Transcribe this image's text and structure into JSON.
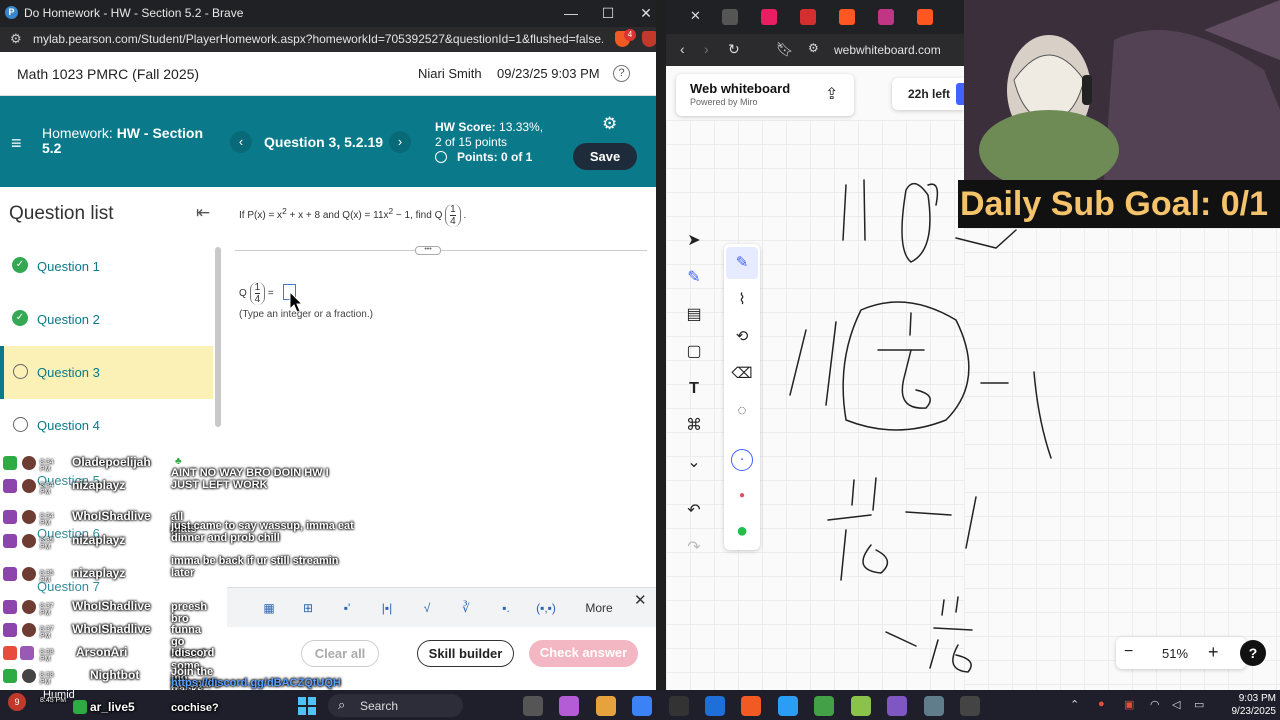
{
  "left_browser": {
    "tab_title": "Do Homework - HW - Section 5.2 - Brave",
    "url": "mylab.pearson.com/Student/PlayerHomework.aspx?homeworkId=705392527&questionId=1&flushed=false...",
    "controls": {
      "minimize": "—",
      "maximize": "☐",
      "close": "✕"
    },
    "badge_count": "4"
  },
  "course_bar": {
    "course": "Math 1023 PMRC (Fall 2025)",
    "user": "Niari Smith",
    "datetime": "09/23/25 9:03 PM",
    "help": "?"
  },
  "hw_header": {
    "menu_icon": "≡",
    "hw_prefix": "Homework:",
    "hw_name": "HW - Section 5.2",
    "prev": "‹",
    "next": "›",
    "question_label": "Question 3, 5.2.19",
    "score_label": "HW Score:",
    "score_value": "13.33%,",
    "score_points": "2 of 15 points",
    "points": "Points: 0 of 1",
    "save": "Save",
    "accent": "#0a7a8a"
  },
  "question_list": {
    "heading": "Question list",
    "items": [
      {
        "label": "Question 1",
        "status": "complete"
      },
      {
        "label": "Question 2",
        "status": "complete"
      },
      {
        "label": "Question 3",
        "status": "current"
      },
      {
        "label": "Question 4",
        "status": "incomplete"
      },
      {
        "label": "Question 5",
        "status": "incomplete"
      },
      {
        "label": "Question 6",
        "status": "incomplete"
      },
      {
        "label": "Question 7",
        "status": "incomplete"
      }
    ]
  },
  "question": {
    "prompt_a": "If P(x) = x",
    "prompt_b": "2",
    "prompt_c": " + x + 8 and Q(x) = 11x",
    "prompt_d": "2",
    "prompt_e": " − 1, find Q",
    "frac_num": "1",
    "frac_den": "4",
    "prompt_end": ".",
    "answer_prefix": "Q",
    "answer_eq": "=",
    "hint": "(Type an integer or a fraction.)",
    "dots": "•••"
  },
  "math_toolbar": {
    "tools": [
      "▦",
      "⊞",
      "▪'",
      "|▪|",
      "√",
      "∛",
      "▪.",
      "(▪,▪)"
    ],
    "more": "More",
    "close": "✕"
  },
  "bottom_buttons": {
    "clear": "Clear all",
    "skill": "Skill builder",
    "check": "Check answer"
  },
  "chat": [
    {
      "time": "8:34 PM",
      "user": "Oladepoelijah",
      "msg": "",
      "badge": "mod"
    },
    {
      "time": "8:34 PM",
      "user": "nizaplayz",
      "msg": "AINT NO WAY BRO DOIN HW I JUST LEFT WORK"
    },
    {
      "time": "8:34 PM",
      "user": "WhoIShadlive",
      "msg": "all plats"
    },
    {
      "time": "8:35 PM",
      "user": "nizaplayz",
      "msg": "just came to say wassup, imma eat dinner and prob chill"
    },
    {
      "time": "8:35 PM",
      "user": "nizaplayz",
      "msg": "imma be back if ur still streamin later"
    },
    {
      "time": "8:37 PM",
      "user": "WhoIShadlive",
      "msg": "preesh bro"
    },
    {
      "time": "8:37 PM",
      "user": "WhoIShadlive",
      "msg": "funna go record some mo tracks"
    },
    {
      "time": "8:38 PM",
      "user": "ArsonAri",
      "msg": "!discord"
    },
    {
      "time": "8:38 PM",
      "user": "Nightbot",
      "msg": "Join the Arsenal's discord server:",
      "link": "https://discord.gg/dBACZQtUQH"
    },
    {
      "time": "8:45 PM",
      "user": "ar_live5",
      "msg": "cochise?"
    }
  ],
  "right_browser": {
    "url": "webwhiteboard.com",
    "app_name": "Web whiteboard",
    "powered": "Powered by Miro",
    "timer": "22h left",
    "tools": [
      "➤",
      "✎",
      "▤",
      "▢",
      "T",
      "⌘",
      "⌄",
      "↶",
      "↷"
    ],
    "subtools": [
      "✎",
      "⌇",
      "⟲",
      "⌫",
      "◌",
      "·",
      "●",
      "●"
    ],
    "zoom_minus": "−",
    "zoom_level": "51%",
    "zoom_plus": "+",
    "help": "?"
  },
  "overlay": {
    "goal": "Daily Sub Goal: 0/1"
  },
  "taskbar": {
    "weather_badge": "9",
    "weather_text": "Humid",
    "search": "Search",
    "time": "9:03 PM",
    "date": "9/23/2025"
  }
}
